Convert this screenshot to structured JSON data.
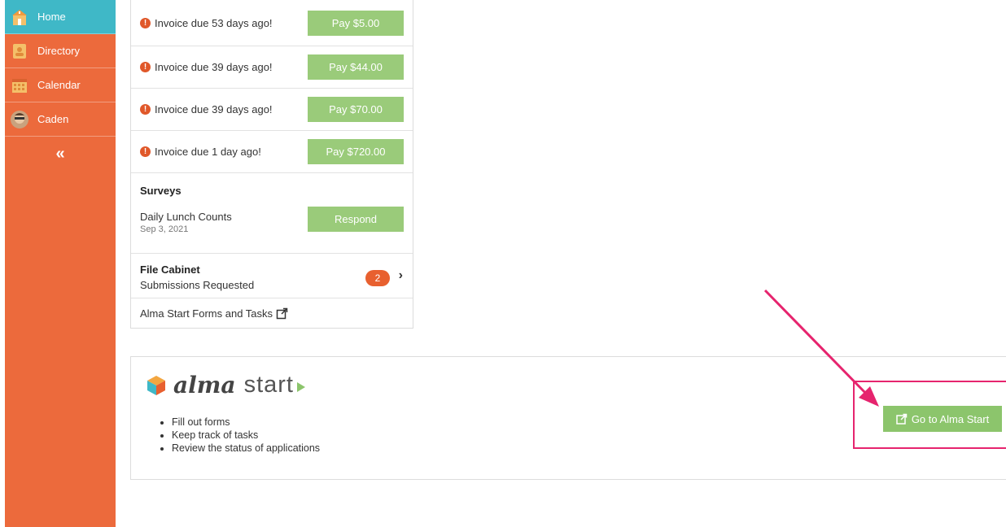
{
  "sidebar": {
    "items": [
      {
        "label": "Home",
        "icon": "school-icon",
        "active": true
      },
      {
        "label": "Directory",
        "icon": "directory-icon",
        "active": false
      },
      {
        "label": "Calendar",
        "icon": "calendar-icon",
        "active": false
      },
      {
        "label": "Caden",
        "icon": "avatar",
        "active": false
      }
    ],
    "collapse_label": "«"
  },
  "invoices": [
    {
      "text": "Invoice due 53 days ago!",
      "button": "Pay $5.00"
    },
    {
      "text": "Invoice due 39 days ago!",
      "button": "Pay $44.00"
    },
    {
      "text": "Invoice due 39 days ago!",
      "button": "Pay $70.00"
    },
    {
      "text": "Invoice due 1 day ago!",
      "button": "Pay $720.00"
    }
  ],
  "surveys": {
    "title": "Surveys",
    "name": "Daily Lunch Counts",
    "date": "Sep 3, 2021",
    "button": "Respond"
  },
  "file_cabinet": {
    "title": "File Cabinet",
    "subtitle": "Submissions Requested",
    "count": "2"
  },
  "tasks_link": "Alma Start Forms and Tasks",
  "alma_start": {
    "logo_word": "alma",
    "logo_start": "start",
    "features": [
      "Fill out forms",
      "Keep track of tasks",
      "Review the status of applications"
    ],
    "button": "Go to Alma Start"
  },
  "colors": {
    "sidebar": "#ec6a3c",
    "active_nav": "#3fb8c7",
    "button_green": "#9acb7a",
    "highlight": "#e6246e"
  }
}
